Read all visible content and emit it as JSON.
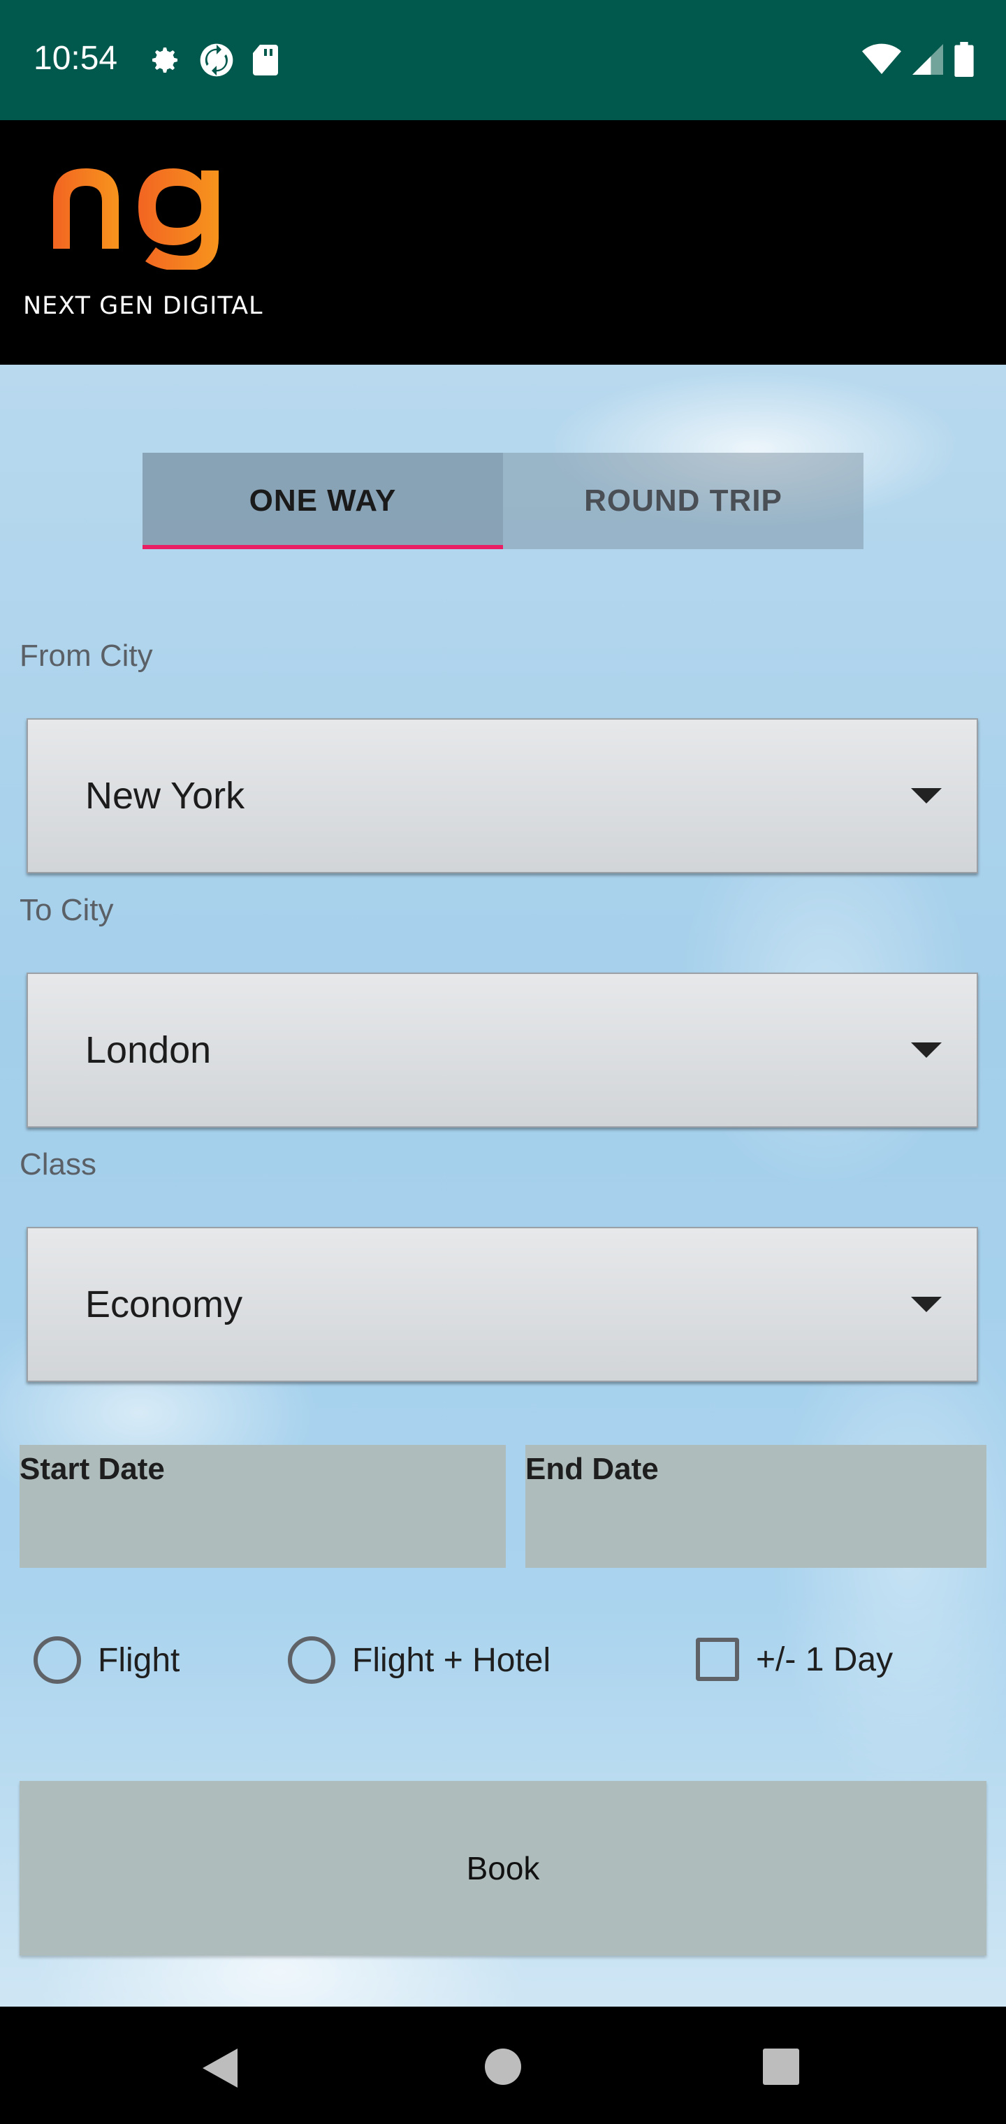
{
  "status_bar": {
    "time": "10:54",
    "icons": [
      "settings-icon",
      "sync-icon",
      "sd-card-icon",
      "wifi-icon",
      "signal-icon",
      "battery-icon"
    ]
  },
  "header": {
    "logo_text": "NEXT GEN DIGITAL",
    "logo_mark": "ng",
    "logo_color": "#f36f21"
  },
  "tabs": [
    {
      "label": "ONE WAY",
      "active": true
    },
    {
      "label": "ROUND TRIP",
      "active": false
    }
  ],
  "form": {
    "from_label": "From City",
    "from_value": "New York",
    "to_label": "To City",
    "to_value": "London",
    "class_label": "Class",
    "class_value": "Economy",
    "start_date_label": "Start Date",
    "end_date_label": "End Date"
  },
  "options": {
    "flight": "Flight",
    "flight_hotel": "Flight + Hotel",
    "flex_day": "+/- 1 Day"
  },
  "book_label": "Book",
  "colors": {
    "status_bar": "#00594c",
    "tab_indicator": "#e91e63",
    "button_bg": "#aebcbb"
  }
}
